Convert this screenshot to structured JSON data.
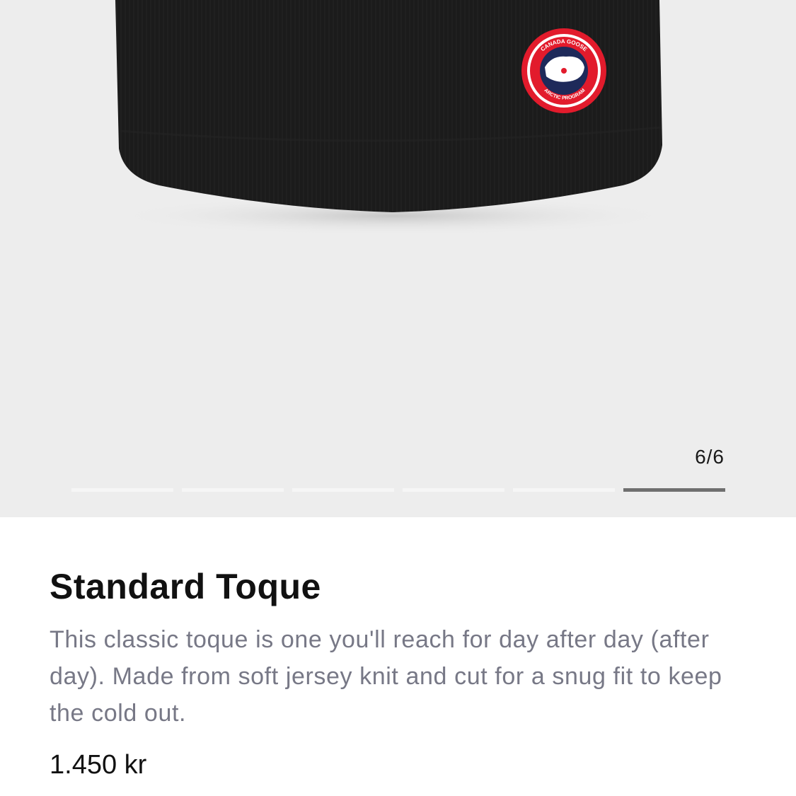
{
  "gallery": {
    "image_alt": "Black knit toque with circular red and navy arctic program patch",
    "patch_text_top": "CANADA GOOSE",
    "patch_text_bottom": "ARCTIC PROGRAM",
    "counter": "6/6",
    "total_slides": 6,
    "active_slide": 6
  },
  "product": {
    "name": "Standard Toque",
    "description": "This classic toque is one you'll reach for day after day (after day). Made from soft jersey knit and cut for a snug fit to keep the cold out.",
    "price": "1.450 kr"
  },
  "colors": {
    "gallery_bg": "#ededed",
    "indicator_active": "#6f6f6f",
    "indicator_inactive": "#f6f6f6",
    "description_text": "#777886",
    "patch_red": "#e21b2c",
    "patch_navy": "#1e2a5a"
  }
}
